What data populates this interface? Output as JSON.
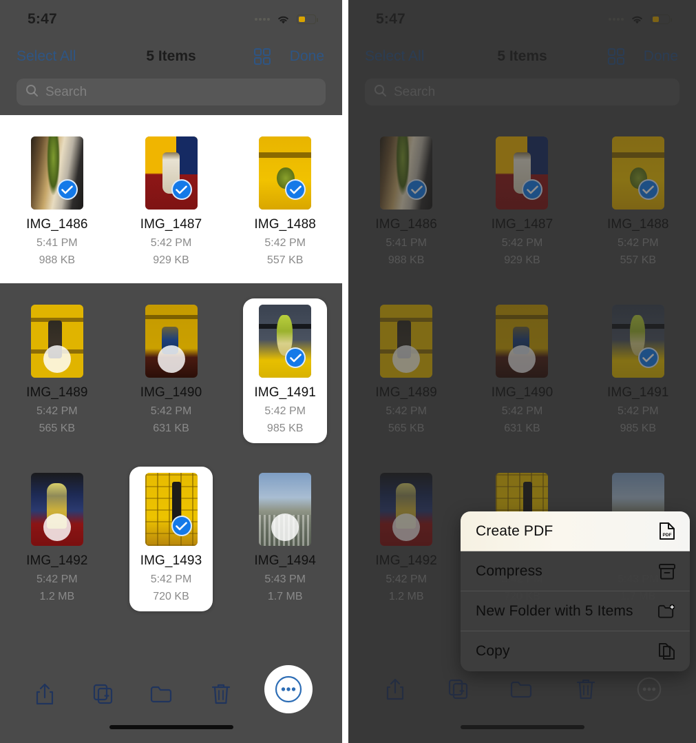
{
  "status_bar": {
    "time": "5:47",
    "wifi_icon": "wifi-icon",
    "battery_icon": "battery-icon",
    "signal_icon": "signal-dots-icon"
  },
  "nav": {
    "select_all_label": "Select All",
    "title": "5 Items",
    "grid_view_icon": "grid-view-icon",
    "done_label": "Done"
  },
  "search": {
    "placeholder": "Search",
    "value": "",
    "icon": "search-icon"
  },
  "files": [
    {
      "name": "IMG_1486",
      "time": "5:41 PM",
      "size": "988 KB",
      "selected": true,
      "art": "art1"
    },
    {
      "name": "IMG_1487",
      "time": "5:42 PM",
      "size": "929 KB",
      "selected": true,
      "art": "art2"
    },
    {
      "name": "IMG_1488",
      "time": "5:42 PM",
      "size": "557 KB",
      "selected": true,
      "art": "art3"
    },
    {
      "name": "IMG_1489",
      "time": "5:42 PM",
      "size": "565 KB",
      "selected": false,
      "art": "art4"
    },
    {
      "name": "IMG_1490",
      "time": "5:42 PM",
      "size": "631 KB",
      "selected": false,
      "art": "art5"
    },
    {
      "name": "IMG_1491",
      "time": "5:42 PM",
      "size": "985 KB",
      "selected": true,
      "art": "art6"
    },
    {
      "name": "IMG_1492",
      "time": "5:42 PM",
      "size": "1.2 MB",
      "selected": false,
      "art": "art7"
    },
    {
      "name": "IMG_1493",
      "time": "5:42 PM",
      "size": "720 KB",
      "selected": true,
      "art": "art8"
    },
    {
      "name": "IMG_1494",
      "time": "5:43 PM",
      "size": "1.7 MB",
      "selected": false,
      "art": "art9"
    }
  ],
  "toolbar": {
    "share_icon": "share-icon",
    "duplicate_icon": "duplicate-icon",
    "folder_icon": "folder-icon",
    "delete_icon": "trash-icon",
    "more_icon": "more-ellipsis-icon"
  },
  "context_menu": {
    "items": [
      {
        "label": "Create PDF",
        "icon": "pdf-document-icon",
        "highlighted": true
      },
      {
        "label": "Compress",
        "icon": "archive-box-icon",
        "highlighted": false
      },
      {
        "label": "New Folder with 5 Items",
        "icon": "folder-plus-icon",
        "highlighted": false
      },
      {
        "label": "Copy",
        "icon": "copy-documents-icon",
        "highlighted": false
      }
    ]
  },
  "colors": {
    "accent_blue": "#1479e8",
    "link_blue": "#2e5584",
    "dim_backdrop": "#4a4a4a",
    "highlight_card": "#ffffff",
    "battery_yellow": "#d9a400"
  }
}
